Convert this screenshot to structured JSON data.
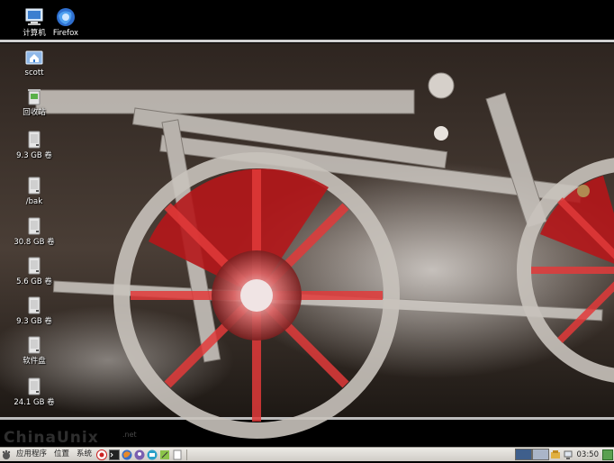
{
  "desktop": {
    "icons": [
      {
        "label": "计算机",
        "icon": "computer-icon"
      },
      {
        "label": "Firefox",
        "icon": "firefox-icon"
      },
      {
        "label": "scott",
        "icon": "home-folder-icon"
      },
      {
        "label": "回收站",
        "icon": "trash-icon"
      },
      {
        "label": "9.3 GB 卷",
        "icon": "drive-icon"
      },
      {
        "label": "/bak",
        "icon": "drive-icon"
      },
      {
        "label": "30.8 GB 卷",
        "icon": "drive-icon"
      },
      {
        "label": "5.6 GB 卷",
        "icon": "drive-icon"
      },
      {
        "label": "9.3 GB 卷",
        "icon": "drive-icon"
      },
      {
        "label": "软件盘",
        "icon": "drive-icon"
      },
      {
        "label": "24.1 GB 卷",
        "icon": "drive-icon"
      }
    ]
  },
  "panel": {
    "menus": [
      "应用程序",
      "位置",
      "系统"
    ],
    "clock": "03:50",
    "workspaces": [
      "active",
      "inactive"
    ],
    "colors": {
      "panel_bg": "#dcd9d4",
      "ws_active": "#3f5f8c",
      "ws_inactive": "#aab5c8"
    }
  },
  "watermark": {
    "text": "ChinaUnix",
    "sub": ".net"
  }
}
